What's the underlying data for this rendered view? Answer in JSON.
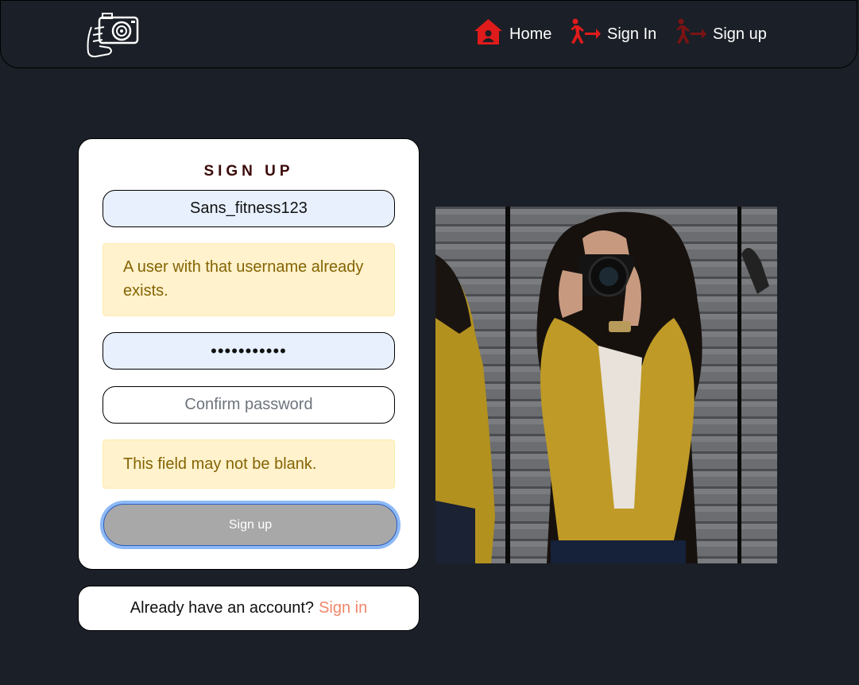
{
  "nav": {
    "home": "Home",
    "sign_in": "Sign In",
    "sign_up": "Sign up",
    "icons": {
      "home": "house-icon",
      "sign_in": "person-running-arrow-icon",
      "sign_up": "person-running-arrow-icon"
    },
    "icon_color": "#e01b1b",
    "icon_color_active": "#7a1414"
  },
  "form": {
    "title": "SIGN UP",
    "username_value": "Sans_fitness123",
    "username_error": "A user with that username already exists.",
    "password_value": "•••••••••••",
    "confirm_placeholder": "Confirm password",
    "confirm_error": "This field may not be blank.",
    "submit_label": "Sign up"
  },
  "signin_prompt": {
    "text": "Already have an account?",
    "link": "Sign in",
    "link_color": "#f0876a"
  },
  "colors": {
    "background": "#1b1f27",
    "alert_bg": "#fff2cc",
    "alert_text": "#856404"
  }
}
